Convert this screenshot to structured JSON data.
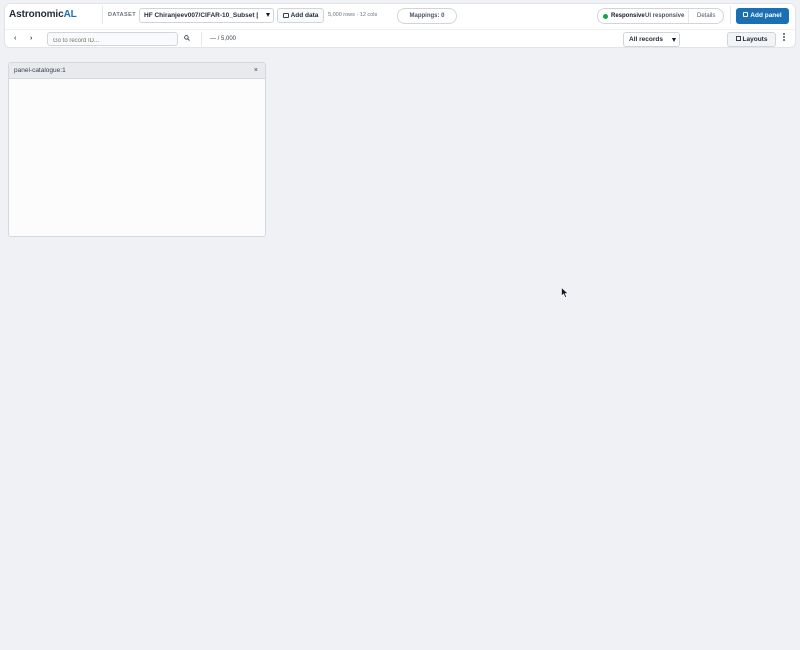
{
  "app": {
    "title_part1": "Astronomic",
    "title_part2": "AL",
    "brand_color": "#1f6fb2"
  },
  "header": {
    "dataset_label": "DATASET",
    "dataset_value": "HF Chiranjeev007/CIFAR-10_Subset [...",
    "add_data_label": "Add data",
    "rows_info": "5,000 rows · 12 cols",
    "mappings_label": "Mappings: 0",
    "status": {
      "label": "Responsive",
      "sub": "UI responsive",
      "details": "Details",
      "color": "#16a34a"
    },
    "add_panel_label": "Add panel",
    "add_panel_color": "#1b6fb3"
  },
  "toolbar": {
    "goto_placeholder": "Go to record ID...",
    "counter": "— / 5,000",
    "filter_value": "All records",
    "layouts_label": "Layouts"
  },
  "panels": [
    {
      "title": "panel-catalogue:1",
      "close": "×"
    }
  ]
}
